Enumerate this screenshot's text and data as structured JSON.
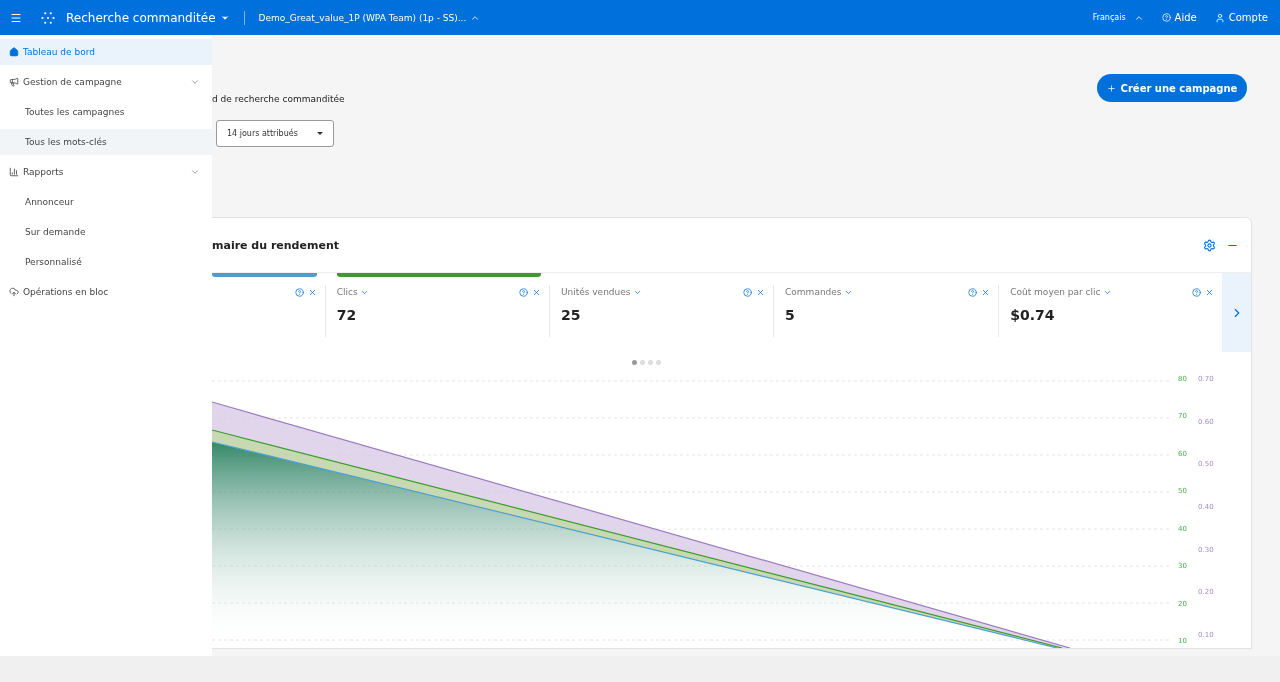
{
  "topbar": {
    "product": "Recherche commanditée",
    "account": "Demo_Great_value_1P (WPA Team) (1p - SS)...",
    "language": "Français",
    "help": "Aide",
    "profile": "Compte"
  },
  "sidebar": {
    "items": [
      {
        "label": "Tableau de bord",
        "selected": true,
        "hovered": false
      },
      {
        "label": "Gestion de campagne",
        "selected": false,
        "hovered": false,
        "expanded": true,
        "children": [
          {
            "label": "Toutes les campagnes",
            "selected": false,
            "hovered": false
          },
          {
            "label": "Tous les mots-clés",
            "selected": false,
            "hovered": true
          }
        ]
      },
      {
        "label": "Rapports",
        "selected": false,
        "hovered": false,
        "expanded": true,
        "children": [
          {
            "label": "Annonceur",
            "selected": false,
            "hovered": false
          },
          {
            "label": "Sur demande",
            "selected": false,
            "hovered": false
          },
          {
            "label": "Personnalisé",
            "selected": false,
            "hovered": false
          }
        ]
      },
      {
        "label": "Opérations en bloc",
        "selected": false,
        "hovered": false
      }
    ]
  },
  "page": {
    "subtitle": "d de recherche commanditée",
    "attribution": "14 jours attribués",
    "create_button": "Créer une campagne"
  },
  "card": {
    "title": "maire du rendement",
    "metrics": [
      {
        "color": "#4a9fd0"
      },
      {
        "label": "Clics",
        "value": "72",
        "color": "#3d9a2c"
      },
      {
        "label": "Unités vendues",
        "value": "25"
      },
      {
        "label": "Commandes",
        "value": "5"
      },
      {
        "label": "Coût moyen par clic",
        "value": "$0.74"
      }
    ],
    "pages": [
      {
        "selected": true
      },
      {
        "selected": false
      },
      {
        "selected": false
      },
      {
        "selected": false
      }
    ],
    "left_axis": [
      "80",
      "70",
      "60",
      "50",
      "40",
      "30",
      "20",
      "10"
    ],
    "right_axis": [
      "0.70",
      "0.60",
      "0.50",
      "0.40",
      "0.30",
      "0.20",
      "0.10"
    ]
  }
}
